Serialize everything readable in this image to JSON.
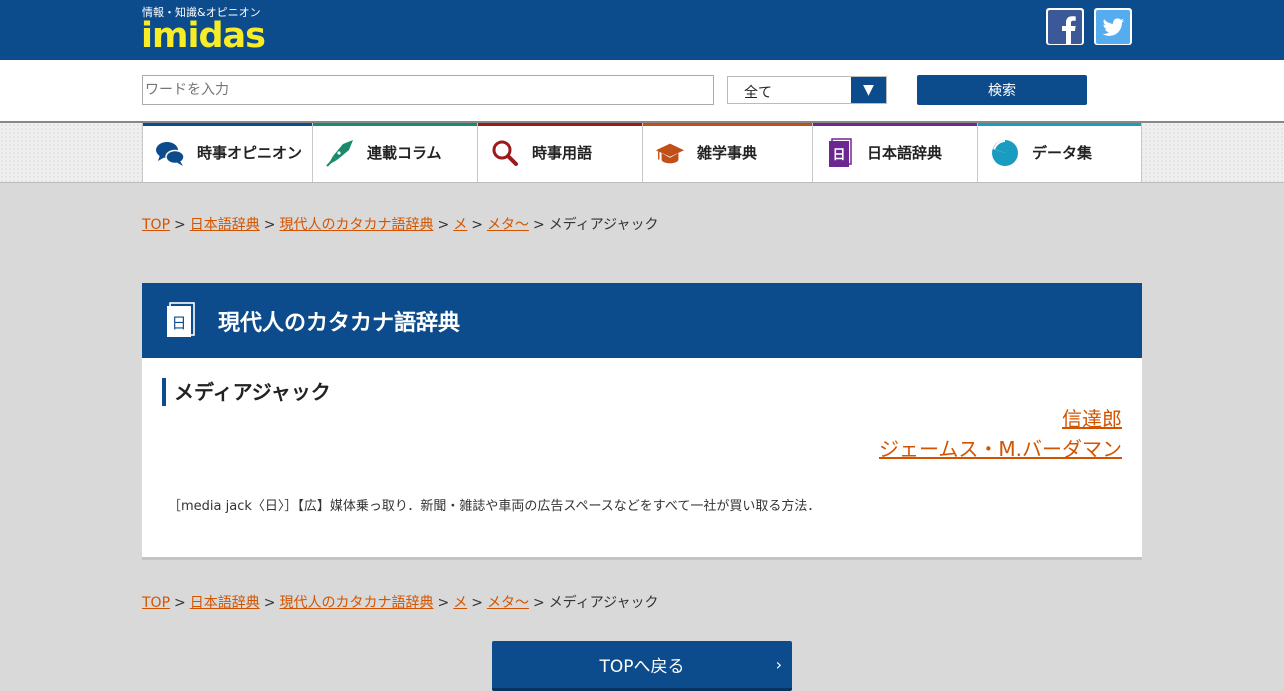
{
  "header": {
    "tagline": "情報・知識&オピニオン",
    "logo": "imidas",
    "facebook_icon": "facebook-icon",
    "twitter_icon": "twitter-icon"
  },
  "search": {
    "placeholder": "ワードを入力",
    "scope_selected": "全て",
    "button_label": "検索"
  },
  "nav": [
    {
      "label": "時事オピニオン",
      "icon": "chat-bubbles-icon",
      "color": "#0d4c8c"
    },
    {
      "label": "連載コラム",
      "icon": "fountain-pen-icon",
      "color": "#1a8a6e"
    },
    {
      "label": "時事用語",
      "icon": "magnifier-icon",
      "color": "#9c1a1a"
    },
    {
      "label": "雑学事典",
      "icon": "graduation-cap-icon",
      "color": "#c0501a"
    },
    {
      "label": "日本語辞典",
      "icon": "dictionary-icon",
      "color": "#6d2790"
    },
    {
      "label": "データ集",
      "icon": "pie-chart-icon",
      "color": "#1a9cc0"
    }
  ],
  "breadcrumb": {
    "items": [
      "TOP",
      "日本語辞典",
      "現代人のカタカナ語辞典",
      "メ",
      "メタ～"
    ],
    "current": "メディアジャック",
    "separator": ">"
  },
  "panel": {
    "title": "現代人のカタカナ語辞典",
    "book_glyph": "日"
  },
  "entry": {
    "title": "メディアジャック",
    "authors": [
      "信達郎",
      "ジェームス・M.バーダマン"
    ],
    "definition": "［media jack〈日〉］【広】媒体乗っ取り．新聞・雑誌や車両の広告スペースなどをすべて一社が買い取る方法．"
  },
  "back_button": {
    "label": "TOPへ戻る",
    "chevron": "›"
  },
  "colors": {
    "brand": "#0d4c8c",
    "logo": "#f7ec26",
    "link": "#d35400"
  }
}
